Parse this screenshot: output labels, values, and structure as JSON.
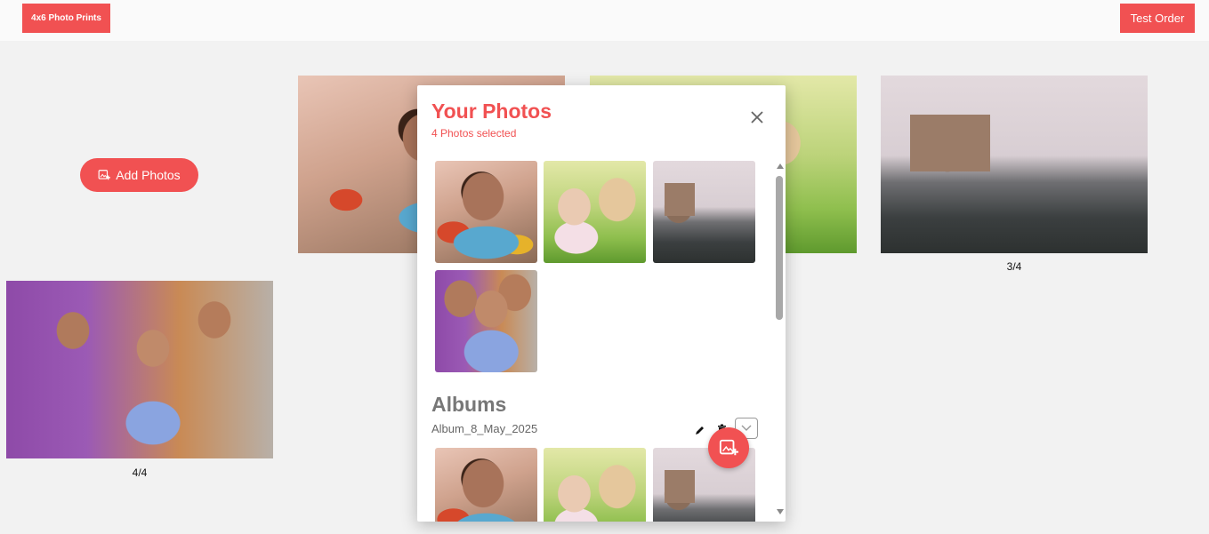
{
  "header": {
    "product_label": "4x6 Photo Prints",
    "test_order_label": "Test Order"
  },
  "canvas": {
    "add_photos_label": "Add Photos",
    "prints": [
      {
        "label": "",
        "photo": "baby-photo"
      },
      {
        "label": "",
        "photo": "teddy-photo"
      },
      {
        "label": "3/4",
        "photo": "gateway-photo"
      },
      {
        "label": "4/4",
        "photo": "family-photo"
      }
    ]
  },
  "dialog": {
    "title": "Your Photos",
    "subtitle": "4 Photos selected",
    "albums_heading": "Albums",
    "album_name": "Album_8_May_2025"
  },
  "colors": {
    "accent": "#f15152",
    "background": "#f2f2f2"
  },
  "icons": [
    "add-photo-icon",
    "close-icon",
    "edit-icon",
    "delete-icon",
    "chevron-down-icon",
    "add-image-icon"
  ]
}
